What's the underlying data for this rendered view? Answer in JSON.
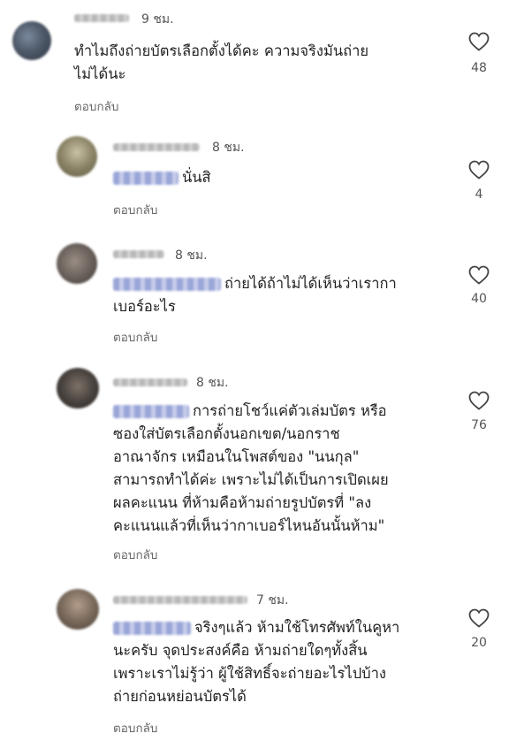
{
  "comments": [
    {
      "time": "9 ชม.",
      "lines": [
        "ทำไมถึงถ่ายบัตรเลือกตั้งได้คะ ความจริงมันถ่าย",
        "ไม่ได้นะ"
      ],
      "reply_label": "ตอบกลับ",
      "likes": "48"
    },
    {
      "time": "8 ชม.",
      "lines": [
        "นั่นสิ"
      ],
      "reply_label": "ตอบกลับ",
      "likes": "4"
    },
    {
      "time": "8 ชม.",
      "lines": [
        "ถ่ายได้ถ้าไม่ได้เห็นว่าเรากา",
        "เบอร์อะไร"
      ],
      "reply_label": "ตอบกลับ",
      "likes": "40"
    },
    {
      "time": "8 ชม.",
      "lines": [
        "การถ่ายโชว์แค่ตัวเล่มบัตร หรือ",
        "ซองใส่บัตรเลือกตั้งนอกเขต/นอกราช",
        "อาณาจักร เหมือนในโพสต์ของ \"นนกุล\"",
        "สามารถทำได้ค่ะ เพราะไม่ได้เป็นการเปิดเผย",
        "ผลคะแนน ที่ห้ามคือห้ามถ่ายรูปบัตรที่ \"ลง",
        "คะแนนแล้วที่เห็นว่ากาเบอร์ไหนอันนั้นห้าม\""
      ],
      "reply_label": "ตอบกลับ",
      "likes": "76"
    },
    {
      "time": "7 ชม.",
      "lines": [
        "จริงๆแล้ว ห้ามใช้โทรศัพท์ในคูหา",
        "นะครับ จุดประสงค์คือ ห้ามถ่ายใดๆทั้งสิ้น",
        "เพราะเราไม่รู้ว่า ผู้ใช้สิทธิ์จะถ่ายอะไรไปบ้าง",
        "ถ่ายก่อนหย่อนบัตรได้"
      ],
      "reply_label": "ตอบกลับ",
      "likes": "20"
    }
  ]
}
